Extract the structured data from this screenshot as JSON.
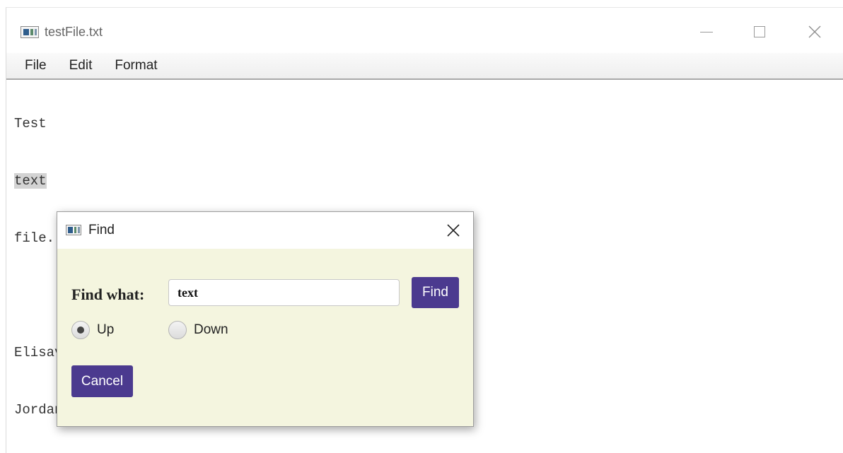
{
  "window": {
    "title": "testFile.txt",
    "icon": "app-window-icon",
    "controls": {
      "minimize": "minimize-icon",
      "maximize": "maximize-icon",
      "close": "close-icon"
    }
  },
  "menubar": {
    "items": [
      {
        "label": "File"
      },
      {
        "label": "Edit"
      },
      {
        "label": "Format"
      }
    ]
  },
  "editor": {
    "lines": [
      "Test",
      "text",
      "file.",
      "",
      "Elisaveta",
      "Jordan"
    ],
    "selected_text": "text"
  },
  "find_dialog": {
    "title": "Find",
    "find_label": "Find what:",
    "search_value": "text",
    "find_button": "Find",
    "cancel_button": "Cancel",
    "direction": {
      "options": [
        {
          "label": "Up",
          "checked": true
        },
        {
          "label": "Down",
          "checked": false
        }
      ]
    },
    "colors": {
      "background": "#f4f5df",
      "button": "#4b3a8f"
    }
  }
}
